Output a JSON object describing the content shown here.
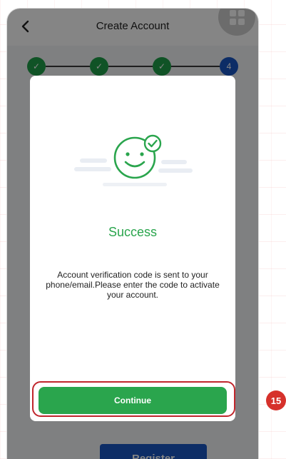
{
  "header": {
    "back_icon": "chevron-left-icon",
    "title": "Create Account",
    "menu_icon": "grid-icon"
  },
  "stepper": {
    "steps": [
      {
        "state": "done",
        "label": "✓"
      },
      {
        "state": "done",
        "label": "✓"
      },
      {
        "state": "done",
        "label": "✓"
      },
      {
        "state": "current",
        "label": "4"
      }
    ]
  },
  "background_form": {
    "register_label": "Register"
  },
  "dialog": {
    "icon": "smiley-check-icon",
    "title": "Success",
    "message": "Account verification code is sent to your phone/email.Please enter the code to activate your account.",
    "continue_label": "Continue"
  },
  "annotation": {
    "step_number": "15"
  },
  "colors": {
    "success_green": "#2aa54d",
    "step_blue": "#1a56c4",
    "highlight_red": "#c0262c"
  }
}
